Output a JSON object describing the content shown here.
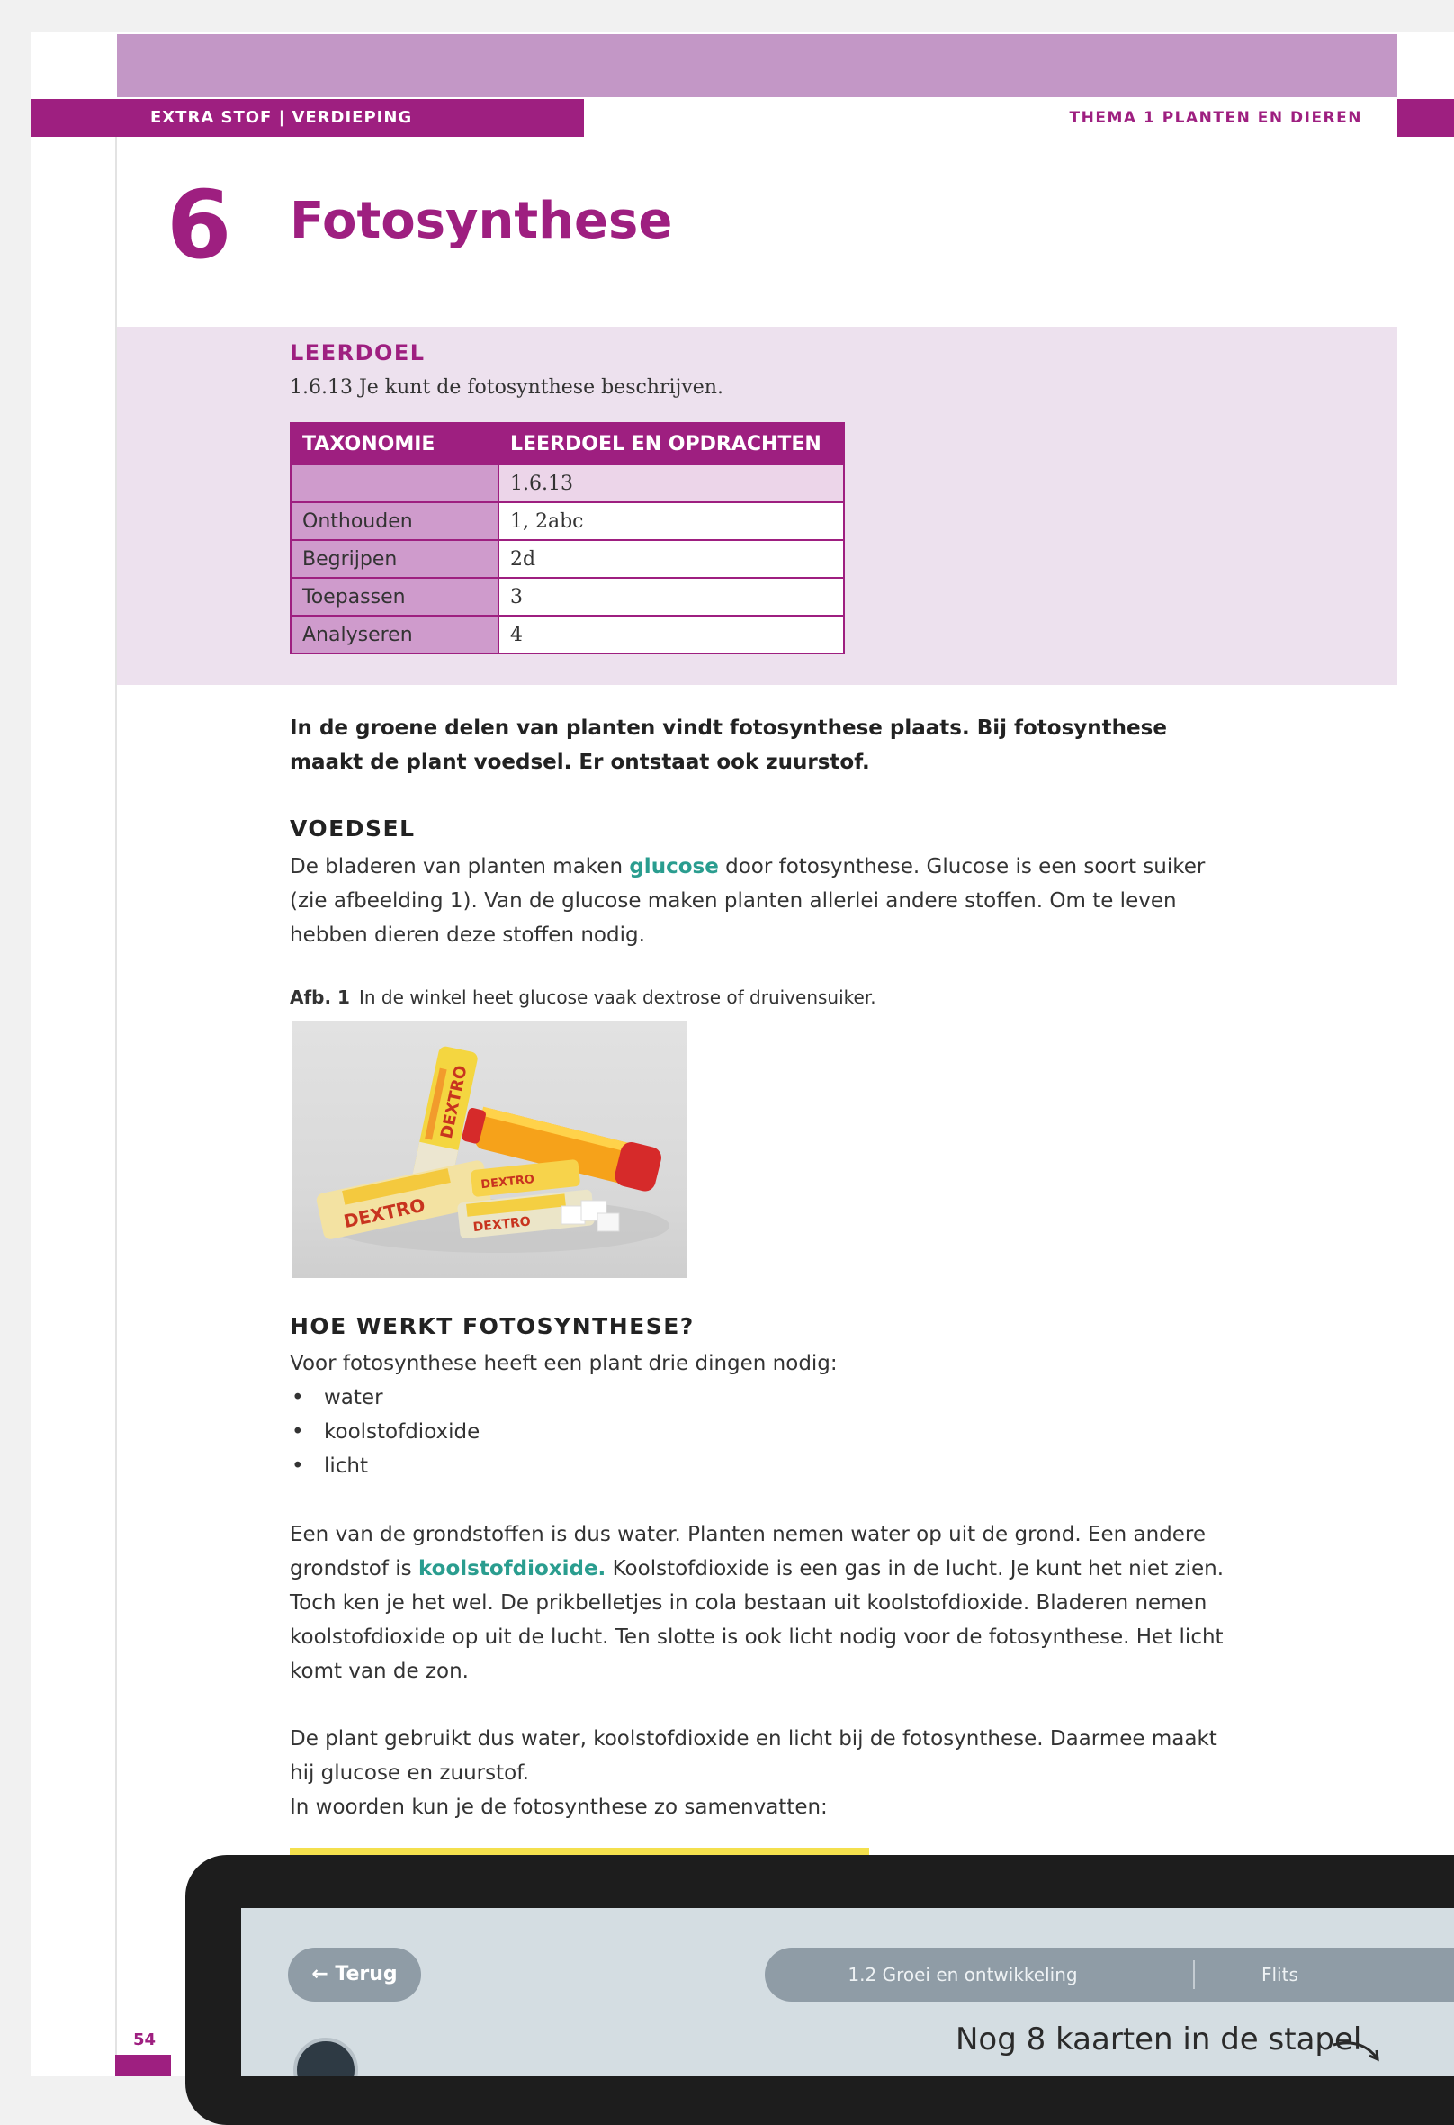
{
  "header": {
    "left_band": "EXTRA STOF | VERDIEPING",
    "right_band": "THEMA 1  PLANTEN EN DIEREN"
  },
  "chapter": {
    "number": "6",
    "title": "Fotosynthese"
  },
  "leerdoel": {
    "heading": "LEERDOEL",
    "text": "1.6.13 Je kunt de fotosynthese beschrijven.",
    "table": {
      "headers": [
        "TAXONOMIE",
        "LEERDOEL EN OPDRACHTEN"
      ],
      "subheader": [
        "",
        "1.6.13"
      ],
      "rows": [
        [
          "Onthouden",
          "1, 2abc"
        ],
        [
          "Begrijpen",
          "2d"
        ],
        [
          "Toepassen",
          "3"
        ],
        [
          "Analyseren",
          "4"
        ]
      ]
    }
  },
  "intro": "In de groene delen van planten vindt fotosynthese plaats. Bij fotosynthese maakt de plant voedsel. Er ontstaat ook zuurstof.",
  "voedsel": {
    "heading": "VOEDSEL",
    "before_term": "De bladeren van planten maken ",
    "term": "glucose",
    "after_term": " door fotosynthese. Glucose is een soort suiker (zie afbeelding 1). Van de glucose maken planten allerlei andere stoffen. Om te leven hebben dieren deze stoffen nodig."
  },
  "figure": {
    "label": "Afb. 1",
    "caption": "In de winkel heet glucose vaak dextrose of druivensuiker.",
    "packs": [
      "DEXTRO",
      "DEXTRO",
      "DEXTRO",
      "DEXTRO"
    ]
  },
  "hoe_werkt": {
    "heading": "HOE WERKT FOTOSYNTHESE?",
    "lead": "Voor fotosynthese heeft een plant drie dingen nodig:",
    "items": [
      "water",
      "koolstofdioxide",
      "licht"
    ]
  },
  "grondstoffen": {
    "before_term": "Een van de grondstoffen is dus water. Planten nemen water op uit de grond. Een andere grondstof is ",
    "term": "koolstofdioxide.",
    "after_term": " Koolstofdioxide is een gas in de lucht. Je kunt het niet zien. Toch ken je het wel. De prikbelletjes in cola bestaan uit koolstofdioxide. Bladeren nemen koolstofdioxide op uit de lucht. Ten slotte is ook licht nodig voor de fotosynthese. Het licht komt van de zon."
  },
  "samenvatting": {
    "p1": "De plant gebruikt dus water, koolstofdioxide en licht bij de fotosynthese. Daarmee maakt hij glucose en zuurstof.",
    "p2": "In woorden kun je de fotosynthese zo samenvatten:"
  },
  "page_number": "54",
  "device_screen": {
    "back_button": "← Terug",
    "breadcrumb": "1.2 Groei en ontwikkeling",
    "breadcrumb_right": "Flits",
    "deck_note": "Nog 8 kaarten in de stapel"
  },
  "colors": {
    "accent_magenta": "#9e1f80",
    "lilac_band": "#c397c6",
    "goal_box": "#ede1ee",
    "term_teal": "#2a9d8f",
    "summary_yellow": "#f4e04d"
  }
}
